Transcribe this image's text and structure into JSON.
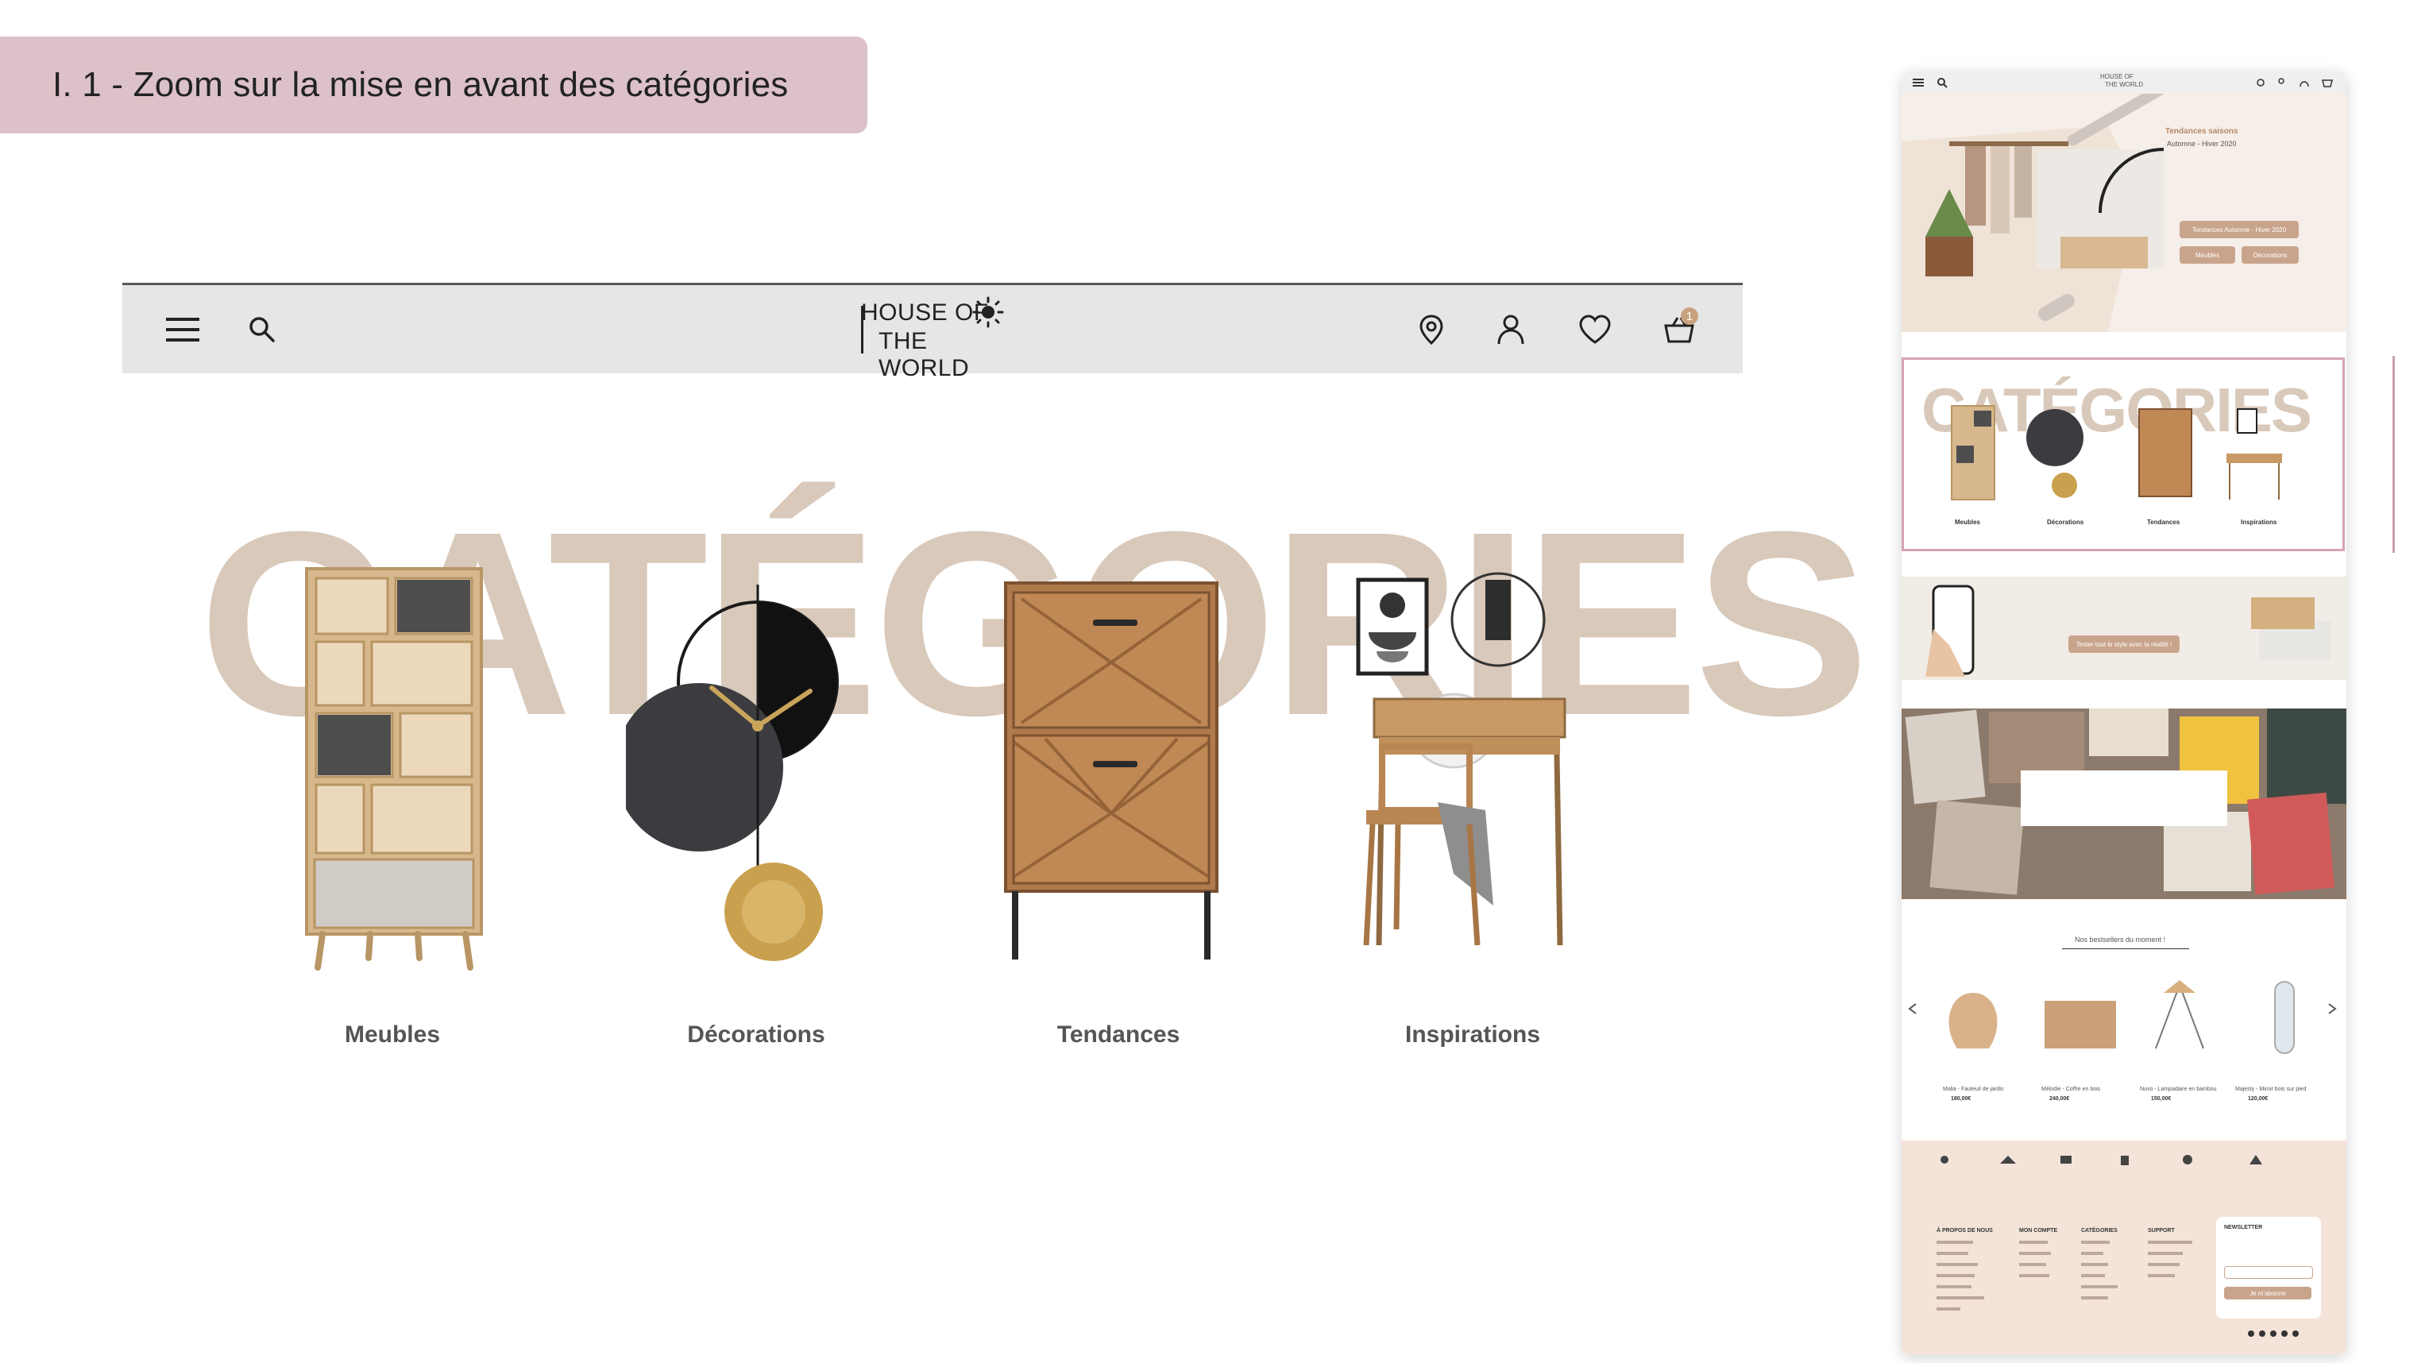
{
  "section_tag": {
    "text": "I. 1 - Zoom sur la mise en avant des catégories"
  },
  "header": {
    "logo_line1": "HOUSE OF",
    "logo_line2": "THE WORLD",
    "cart_count": "1",
    "icons": [
      "menu-icon",
      "search-icon",
      "location-pin-icon",
      "user-icon",
      "heart-icon",
      "basket-icon"
    ]
  },
  "categories": {
    "title": "CATÉGORIES",
    "items": [
      {
        "label": "Meubles"
      },
      {
        "label": "Décorations"
      },
      {
        "label": "Tendances"
      },
      {
        "label": "Inspirations"
      }
    ]
  },
  "preview": {
    "logo_line1": "HOUSE OF",
    "logo_line2": "THE WORLD",
    "hero_title": "Tendances saisons",
    "hero_subtitle": "Automne - Hiver 2020",
    "hero_btn_main": "Tendances Automne - Hiver 2020",
    "hero_btn_1": "Meubles",
    "hero_btn_2": "Décorations",
    "cat_title": "CATÉGORIES",
    "cat_labels": [
      "Meubles",
      "Décorations",
      "Tendances",
      "Inspirations"
    ],
    "ar_btn": "Tester tout le style avec la réalité !",
    "bestsellers_title": "Nos bestsellers du moment !",
    "products": [
      {
        "name": "Malia - Fauteuil de jardin",
        "price": "180,00€"
      },
      {
        "name": "Mélodie - Coffre en bois",
        "price": "240,00€"
      },
      {
        "name": "Nuvo - Lampadaire en bambou",
        "price": "150,00€"
      },
      {
        "name": "Majesty - Miroir bois sur pied",
        "price": "120,00€"
      }
    ],
    "footer_cols": [
      "À PROPOS DE NOUS",
      "MON COMPTE",
      "CATÉGORIES",
      "SUPPORT"
    ],
    "newsletter_title": "NEWSLETTER",
    "newsletter_btn": "Je m'abonne"
  },
  "colors": {
    "accent": "#c9a48c",
    "tag_bg": "#dcc2c8",
    "title_watermark": "#d9c9bb"
  }
}
